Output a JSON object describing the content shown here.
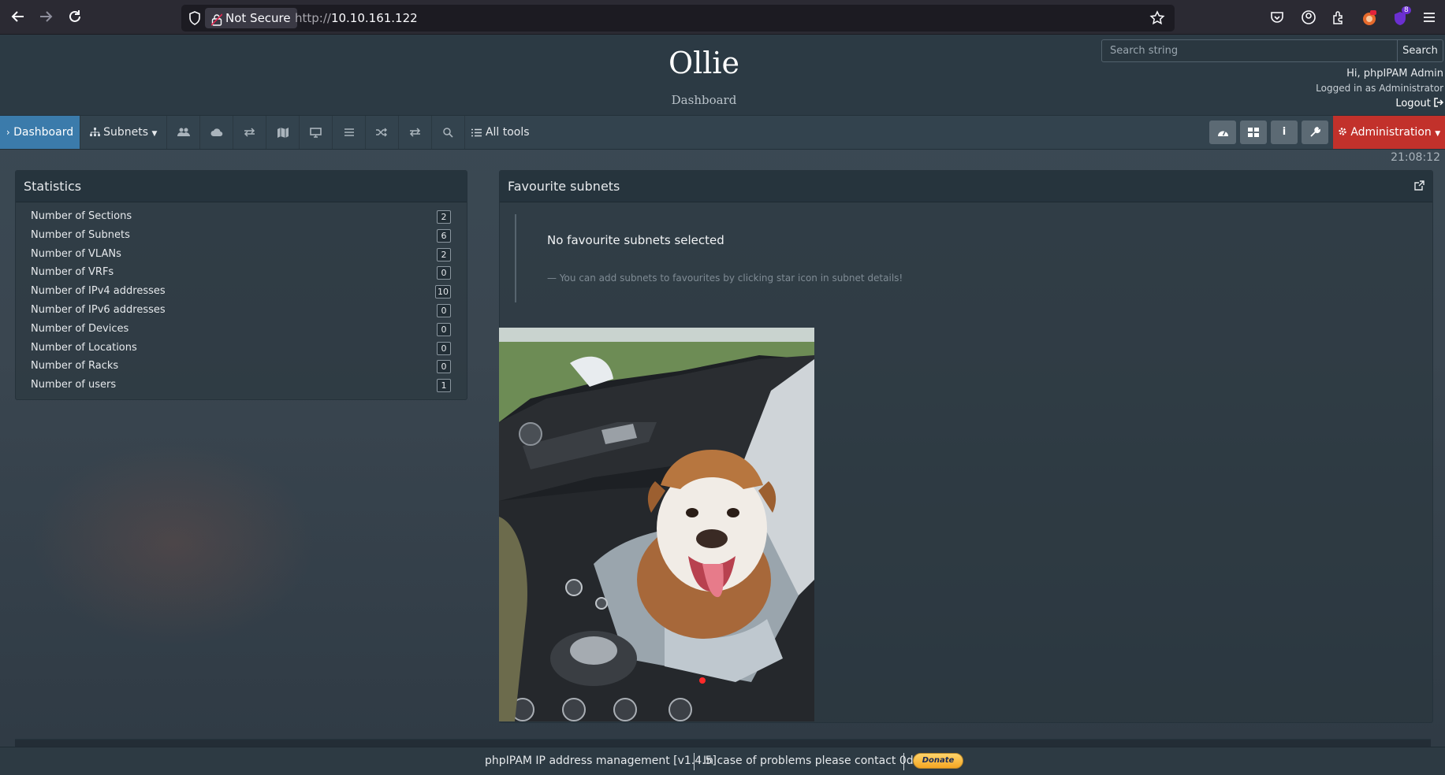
{
  "browser": {
    "security_label": "Not Secure",
    "url_protocol": "http://",
    "url_host": "10.10.161.122",
    "extension_badge": "8"
  },
  "header": {
    "title": "Ollie",
    "subtitle": "Dashboard",
    "search_placeholder": "Search string",
    "search_button": "Search",
    "greeting": "Hi, phpIPAM Admin",
    "logged_in": "Logged in as  Administrator",
    "logout": "Logout"
  },
  "nav": {
    "dashboard": "Dashboard",
    "subnets": "Subnets",
    "all_tools": "All tools",
    "administration": "Administration",
    "clock": "21:08:12"
  },
  "statistics": {
    "title": "Statistics",
    "rows": [
      {
        "label": "Number of Sections",
        "value": "2"
      },
      {
        "label": "Number of Subnets",
        "value": "6"
      },
      {
        "label": "Number of VLANs",
        "value": "2"
      },
      {
        "label": "Number of VRFs",
        "value": "0"
      },
      {
        "label": "Number of IPv4 addresses",
        "value": "10"
      },
      {
        "label": "Number of IPv6 addresses",
        "value": "0"
      },
      {
        "label": "Number of Devices",
        "value": "0"
      },
      {
        "label": "Number of Locations",
        "value": "0"
      },
      {
        "label": "Number of Racks",
        "value": "0"
      },
      {
        "label": "Number of users",
        "value": "1"
      }
    ]
  },
  "favourites": {
    "title": "Favourite subnets",
    "empty_message": "No favourite subnets selected",
    "hint": "— You can add subnets to favourites by clicking star icon in subnet details!"
  },
  "footer": {
    "app": "phpIPAM IP address management [v1.4.5]",
    "contact": "In case of problems please contact 0day",
    "donate": "Donate"
  },
  "colors": {
    "accent_active": "#3b7bab",
    "admin_red": "#c2312b",
    "panel_header": "#26343d"
  }
}
